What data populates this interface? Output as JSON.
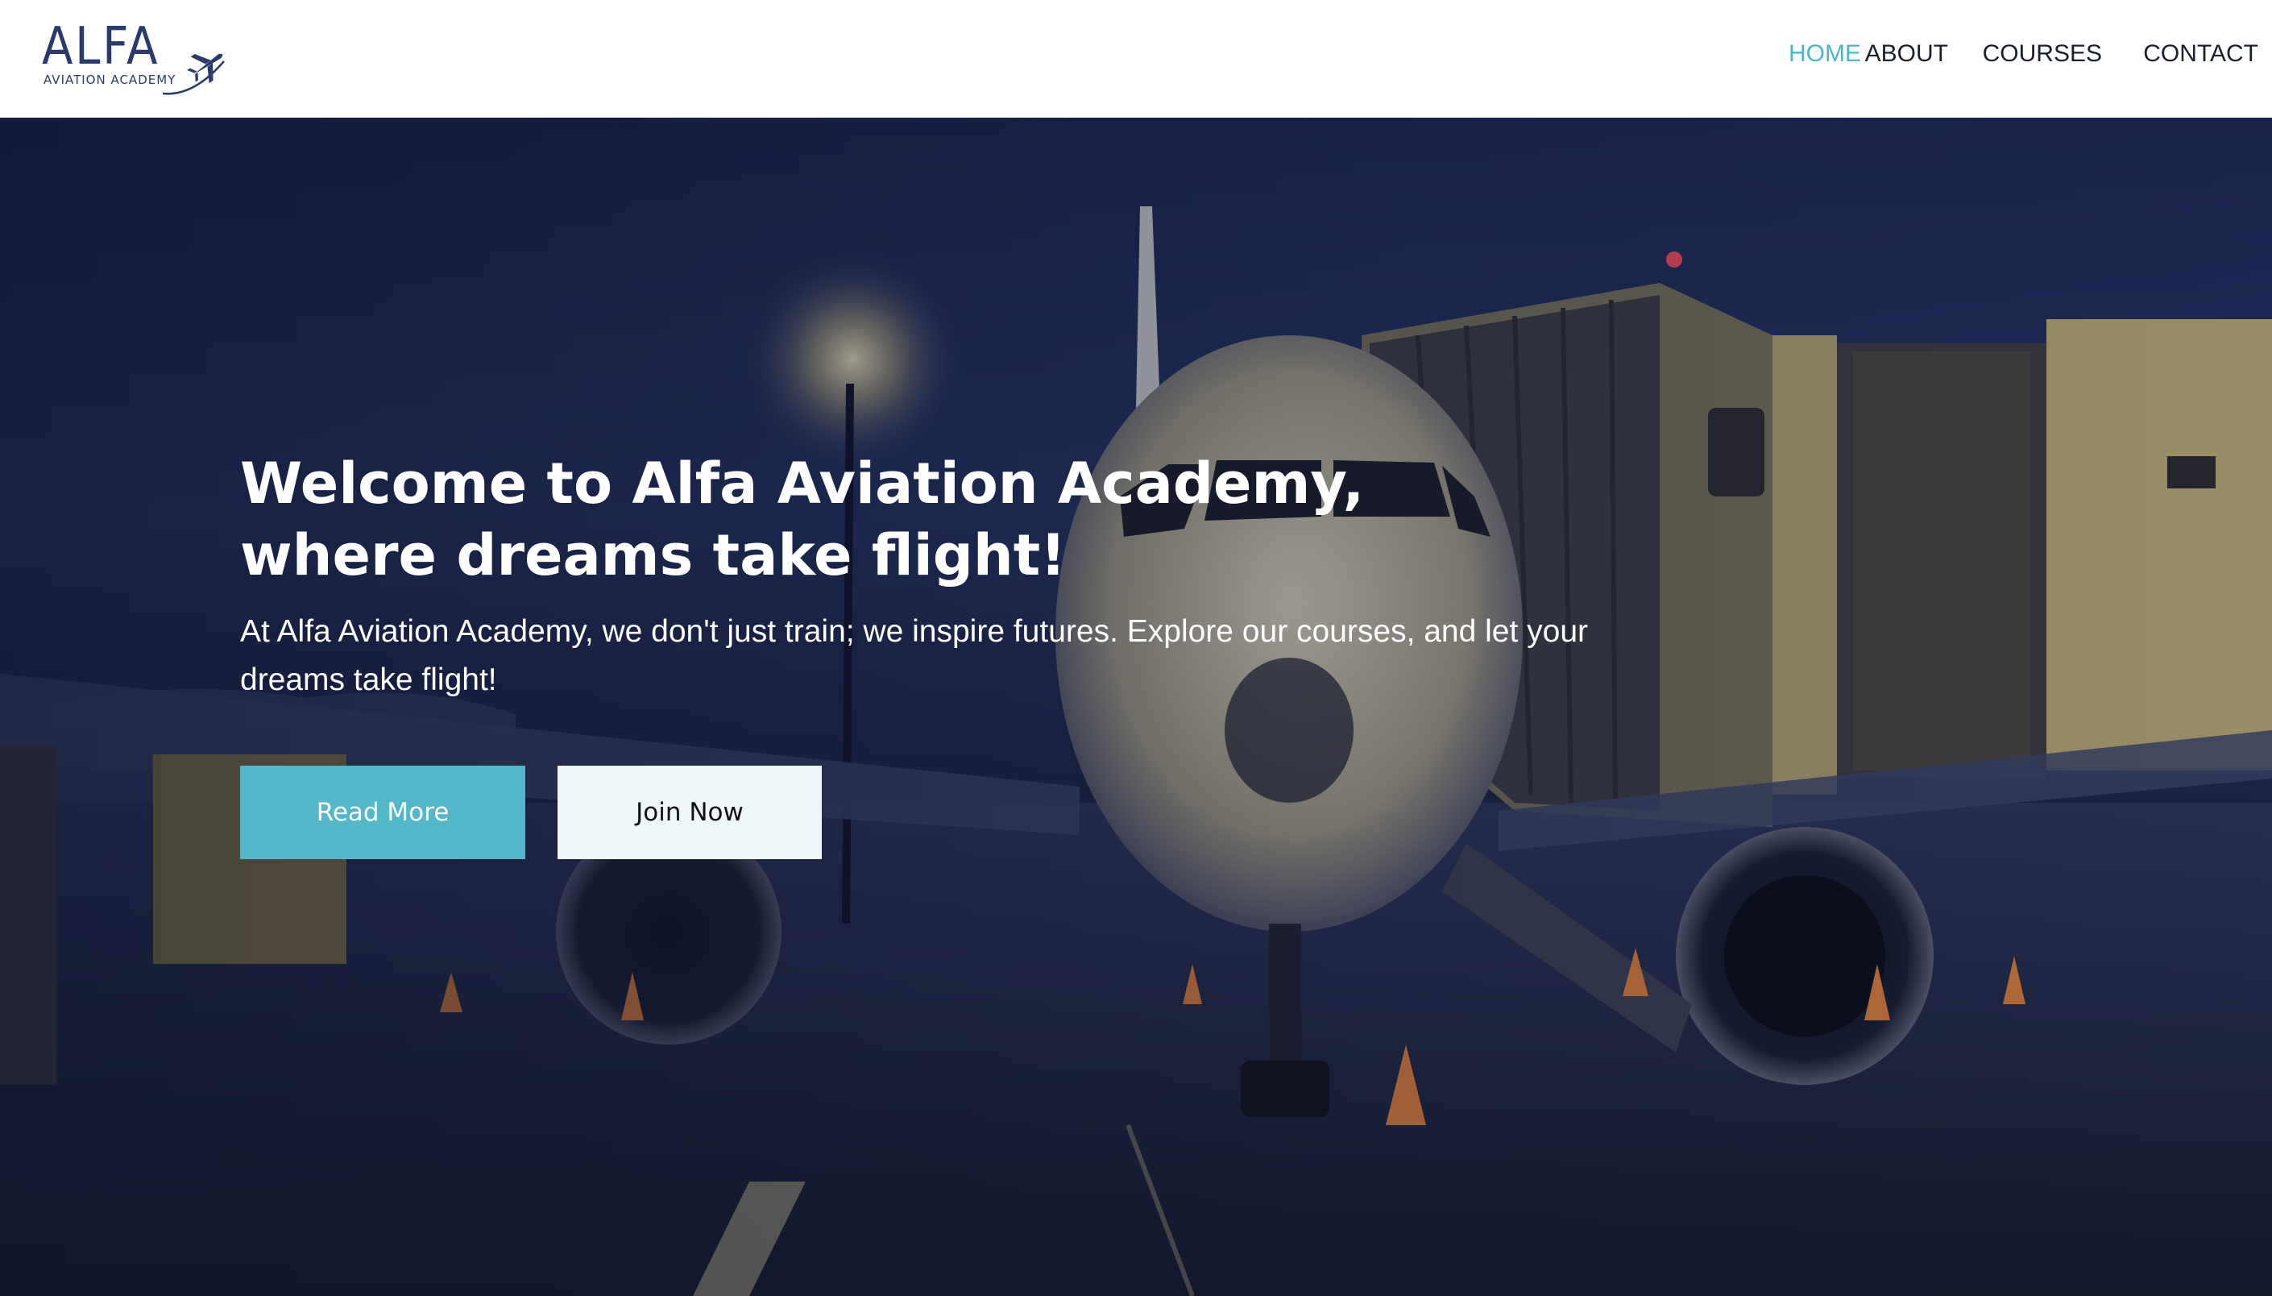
{
  "brand": {
    "name": "ALFA",
    "tagline": "AVIATION ACADEMY"
  },
  "nav": {
    "items": [
      {
        "label": "HOME",
        "active": true
      },
      {
        "label": "ABOUT",
        "active": false
      },
      {
        "label": "COURSES",
        "active": false
      },
      {
        "label": "CONTACT",
        "active": false
      }
    ]
  },
  "hero": {
    "title": "Welcome to Alfa Aviation Academy, where dreams take flight!",
    "text": "At Alfa Aviation Academy, we don't just train; we inspire futures. Explore our courses, and let your dreams take flight!",
    "primary_button": "Read More",
    "secondary_button": "Join Now"
  },
  "colors": {
    "accent": "#4db5c8",
    "brand_navy": "#2a3a6b",
    "button_primary": "#53b6c9",
    "button_secondary": "#eef7fa"
  },
  "icons": {
    "logo": "airplane-icon"
  }
}
